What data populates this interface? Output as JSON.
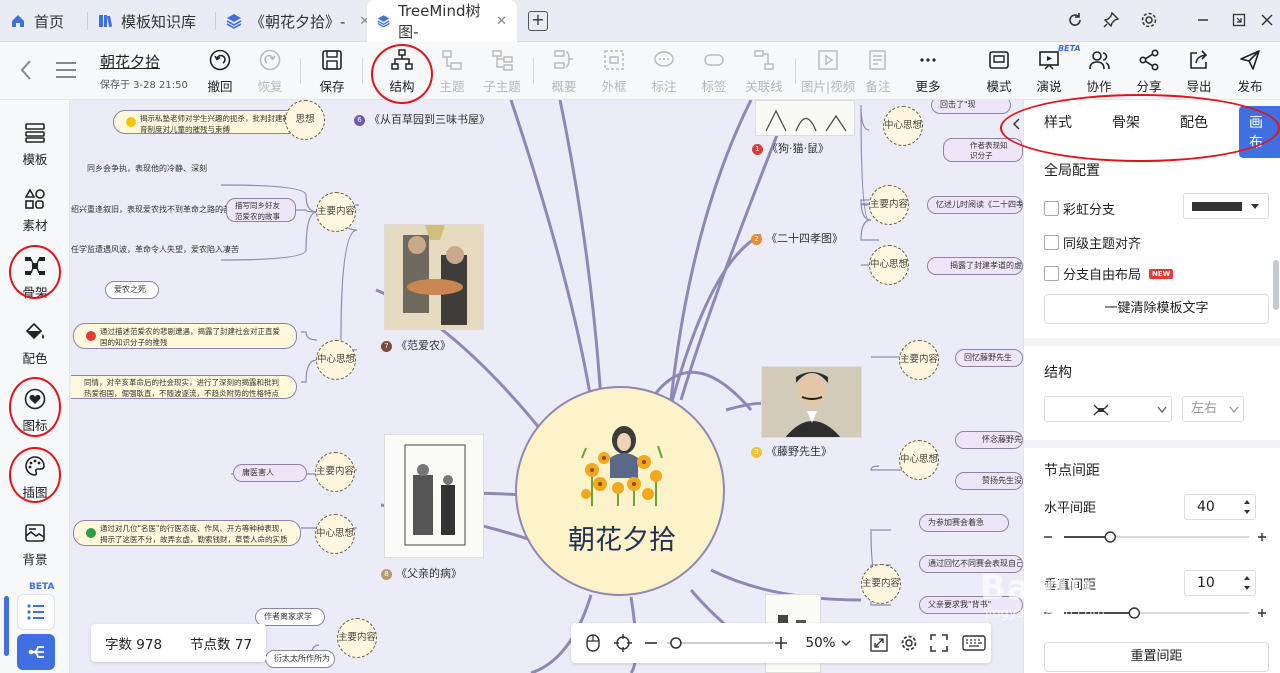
{
  "tabs": [
    {
      "label": "首页"
    },
    {
      "label": "模板知识库"
    },
    {
      "label": "《朝花夕拾》-"
    },
    {
      "label": "TreeMind树图-"
    }
  ],
  "doc": {
    "title": "朝花夕拾",
    "saved": "保存于 3-28 21:50"
  },
  "toolbar": {
    "undo": "撤回",
    "redo": "恢复",
    "save": "保存",
    "structure": "结构",
    "topic": "主题",
    "subtopic": "子主题",
    "summary": "概要",
    "frame": "外框",
    "note": "标注",
    "tag": "标签",
    "relation": "关联线",
    "image_video": "图片|视频",
    "remark": "备注",
    "more": "更多",
    "mode": "模式",
    "present": "演说",
    "present_badge": "BETA",
    "collab": "协作",
    "share": "分享",
    "export": "导出",
    "publish": "发布"
  },
  "sidebar": {
    "items": [
      "模板",
      "素材",
      "骨架",
      "配色",
      "图标",
      "插图",
      "背景"
    ],
    "beta": "BETA"
  },
  "canvas": {
    "center_title": "朝花夕拾",
    "branches": [
      {
        "label": "《从百草园到三味书屋》",
        "num": "6"
      },
      {
        "label": "《狗·猫·鼠》",
        "num": "1"
      },
      {
        "label": "《二十四孝图》",
        "num": "2"
      },
      {
        "label": "《范爱农》",
        "num": "7"
      },
      {
        "label": "《藤野先生》",
        "num": "3"
      },
      {
        "label": "《父亲的病》",
        "num": "8"
      }
    ],
    "circles": {
      "main_content": "主要内容",
      "central_idea": "中心思想",
      "thought": "思想"
    },
    "leaves": {
      "top_left_yellow": "揭示私塾老师对学生兴趣的扼杀，批判封建教育制度对儿童的摧残与束缚",
      "fan_main": "描写同乡好友范爱农的故事",
      "fan_l1": "同乡会争执，表现他的冷静、深刻",
      "fan_l2": "绍兴重逢叙旧，表现爱农找不到革命之路的苦闷",
      "fan_l3": "任学监遭遇风波，革命令人失望，爱农陷入凄苦",
      "fan_death": "爱农之死",
      "fan_idea1": "通过描述范爱农的悲剧遭遇，揭露了封建社会对正直爱国的知识分子的推残",
      "fan_idea2": "同情，对辛亥革命后的社会现实，进行了深刻的揭露和批判热爱祖国，倔强耿直，不随波逐流，不趋炎附势的性格特点",
      "father_main": "庸医害人",
      "father_idea": "通过对几位\"名医\"的行医态度、作风、开方等种种表现，揭示了这医不分，故弄玄虚，勒索钱财，草菅人命的实质",
      "bottom_left_1": "作者离家求学",
      "bottom_left_2": "衍太太所作所为",
      "cat_1": "回击了\"现",
      "cat_2": "作者表现知识分子",
      "x24_1": "忆述儿时阅读《二十四孝",
      "x24_2": "揭露了封建孝道的虚伪",
      "teng_1": "回忆藤野先生",
      "teng_2": "怀念藤野先生",
      "teng_3": "赞扬先生没",
      "br_1": "为参加赛会着急",
      "br_2": "通过回忆不同赛会表现自己的",
      "br_3": "父亲要求我\"背书\""
    }
  },
  "stats": {
    "words_label": "字数 978",
    "nodes_label": "节点数 77"
  },
  "zoom": {
    "level": "50%",
    "slider_value": 0.05
  },
  "rpanel": {
    "tabs": [
      "样式",
      "骨架",
      "配色",
      "画布"
    ],
    "active_tab": "画布",
    "global_title": "全局配置",
    "rainbow": "彩虹分支",
    "align": "同级主题对齐",
    "free_layout": "分支自由布局",
    "new_badge": "NEW",
    "branch_color": "#333333",
    "clear_btn": "一键清除模板文字",
    "struct_title": "结构",
    "struct_dir": "左右",
    "spacing_title": "节点间距",
    "h_spacing_label": "水平间距",
    "h_spacing_value": "40",
    "h_slider": 0.25,
    "v_spacing_label": "垂直间距",
    "v_spacing_value": "10",
    "v_slider": 0.38,
    "reset_btn": "重置间距"
  },
  "watermark": {
    "text": "Baidu 经验",
    "sub": "jingyan.baidu.com"
  }
}
